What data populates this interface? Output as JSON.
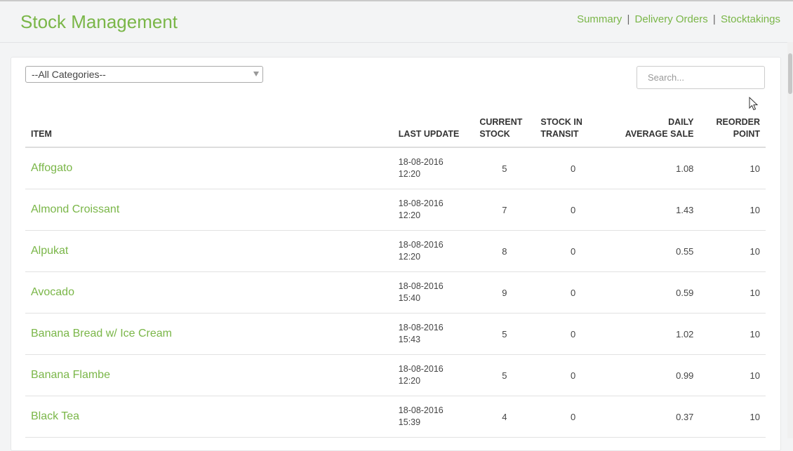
{
  "header": {
    "title": "Stock Management",
    "links": [
      "Summary",
      "Delivery Orders",
      "Stocktakings"
    ],
    "separator": "|"
  },
  "filters": {
    "category_selected": "--All Categories--",
    "search_placeholder": "Search..."
  },
  "table": {
    "columns": {
      "item": "ITEM",
      "last_update": "LAST UPDATE",
      "current_stock": [
        "CURRENT",
        "STOCK"
      ],
      "stock_in_transit": [
        "STOCK IN",
        "TRANSIT"
      ],
      "daily_average_sale": [
        "DAILY",
        "AVERAGE SALE"
      ],
      "reorder_point": [
        "REORDER",
        "POINT"
      ]
    },
    "rows": [
      {
        "item": "Affogato",
        "date": "18-08-2016",
        "time": "12:20",
        "current": "5",
        "transit": "0",
        "daily": "1.08",
        "reorder": "10"
      },
      {
        "item": "Almond Croissant",
        "date": "18-08-2016",
        "time": "12:20",
        "current": "7",
        "transit": "0",
        "daily": "1.43",
        "reorder": "10"
      },
      {
        "item": "Alpukat",
        "date": "18-08-2016",
        "time": "12:20",
        "current": "8",
        "transit": "0",
        "daily": "0.55",
        "reorder": "10"
      },
      {
        "item": "Avocado",
        "date": "18-08-2016",
        "time": "15:40",
        "current": "9",
        "transit": "0",
        "daily": "0.59",
        "reorder": "10"
      },
      {
        "item": "Banana Bread w/ Ice Cream",
        "date": "18-08-2016",
        "time": "15:43",
        "current": "5",
        "transit": "0",
        "daily": "1.02",
        "reorder": "10"
      },
      {
        "item": "Banana Flambe",
        "date": "18-08-2016",
        "time": "12:20",
        "current": "5",
        "transit": "0",
        "daily": "0.99",
        "reorder": "10"
      },
      {
        "item": "Black Tea",
        "date": "18-08-2016",
        "time": "15:39",
        "current": "4",
        "transit": "0",
        "daily": "0.37",
        "reorder": "10"
      }
    ]
  },
  "colors": {
    "accent": "#7ab648",
    "background": "#f3f4f5"
  }
}
